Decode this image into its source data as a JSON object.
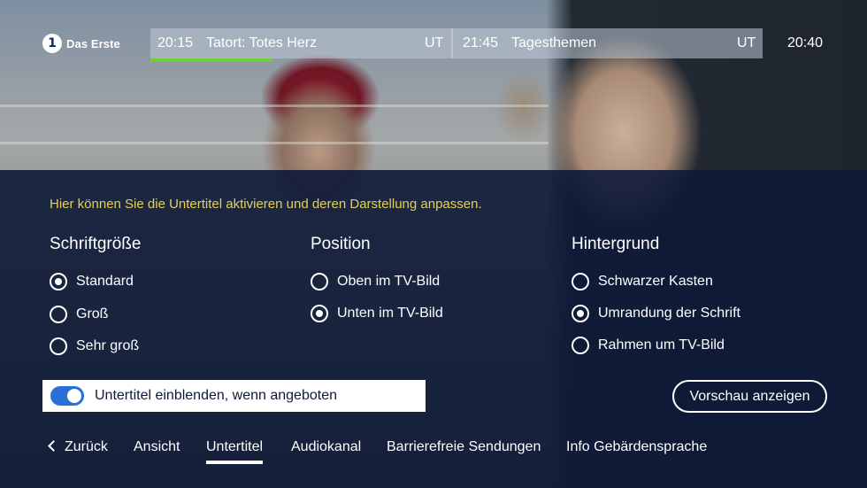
{
  "header": {
    "logo_text": "Das Erste",
    "logo_symbol": "1",
    "now": {
      "time": "20:15",
      "title": "Tatort: Totes Herz",
      "badge": "UT",
      "progress": 0.45
    },
    "next": {
      "time": "21:45",
      "title": "Tagesthemen",
      "badge": "UT"
    },
    "clock": "20:40"
  },
  "panel": {
    "hint": "Hier können Sie die Untertitel aktivieren und deren Darstellung anpassen.",
    "columns": [
      {
        "title": "Schriftgröße",
        "options": [
          {
            "label": "Standard",
            "selected": true
          },
          {
            "label": "Groß",
            "selected": false
          },
          {
            "label": "Sehr groß",
            "selected": false
          }
        ]
      },
      {
        "title": "Position",
        "options": [
          {
            "label": "Oben im TV-Bild",
            "selected": false
          },
          {
            "label": "Unten im TV-Bild",
            "selected": true
          }
        ]
      },
      {
        "title": "Hintergrund",
        "options": [
          {
            "label": "Schwarzer Kasten",
            "selected": false
          },
          {
            "label": "Umrandung der Schrift",
            "selected": true
          },
          {
            "label": "Rahmen um TV-Bild",
            "selected": false
          }
        ]
      }
    ],
    "toggle": {
      "label": "Untertitel einblenden, wenn angeboten",
      "on": true
    },
    "preview_button": "Vorschau anzeigen"
  },
  "nav": {
    "items": [
      {
        "label": "Zurück",
        "icon": "chevron-left-icon"
      },
      {
        "label": "Ansicht"
      },
      {
        "label": "Untertitel",
        "active": true
      },
      {
        "label": "Audiokanal"
      },
      {
        "label": "Barrierefreie Sendungen"
      },
      {
        "label": "Info Gebärdensprache"
      }
    ]
  },
  "colors": {
    "accent_yellow": "#e6cf5a",
    "progress_green": "#6fd12f",
    "toggle_blue": "#2a6fd6",
    "panel_bg": "#0d1a37"
  }
}
